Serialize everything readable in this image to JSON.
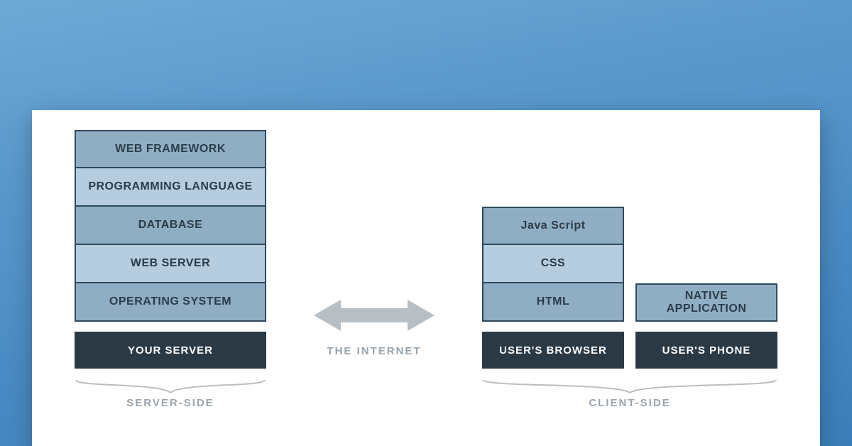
{
  "server": {
    "layers": [
      "WEB FRAMEWORK",
      "PROGRAMMING LANGUAGE",
      "DATABASE",
      "WEB SERVER",
      "OPERATING SYSTEM"
    ],
    "base": "YOUR SERVER",
    "group_label": "SERVER-SIDE"
  },
  "middle": {
    "label": "THE INTERNET"
  },
  "client": {
    "browser": {
      "layers": [
        "Java Script",
        "CSS",
        "HTML"
      ],
      "base": "USER'S BROWSER"
    },
    "phone": {
      "layers": [
        "NATIVE APPLICATION"
      ],
      "base": "USER'S PHONE"
    },
    "group_label": "CLIENT-SIDE"
  }
}
